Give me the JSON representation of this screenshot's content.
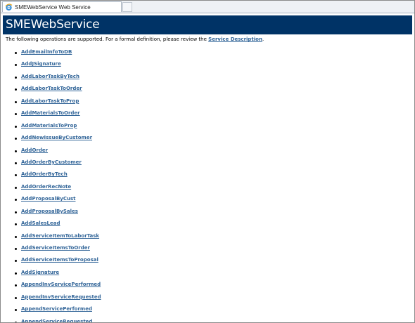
{
  "browser": {
    "tab_title": "SMEWebService Web Service"
  },
  "header": {
    "title": "SMEWebService"
  },
  "intro": {
    "text": "The following operations are supported. For a formal definition, please review the ",
    "link_label": "Service Description",
    "suffix": "."
  },
  "operations": [
    "AddEmailInfoToDB",
    "AddJSignature",
    "AddLaborTaskByTech",
    "AddLaborTaskToOrder",
    "AddLaborTaskToProp",
    "AddMaterialsToOrder",
    "AddMaterialsToProp",
    "AddNewIssueByCustomer",
    "AddOrder",
    "AddOrderByCustomer",
    "AddOrderByTech",
    "AddOrderRecNote",
    "AddProposalByCust",
    "AddProposalBySales",
    "AddSalesLead",
    "AddServiceItemToLaborTask",
    "AddServiceItemsToOrder",
    "AddServiceItemsToProposal",
    "AddSignature",
    "AppendInvServicePerformed",
    "AppendInvServiceRequested",
    "AppendServicePerformed",
    "AppendServiceRequested"
  ],
  "colors": {
    "header_bg": "#003366",
    "link": "#336699"
  }
}
